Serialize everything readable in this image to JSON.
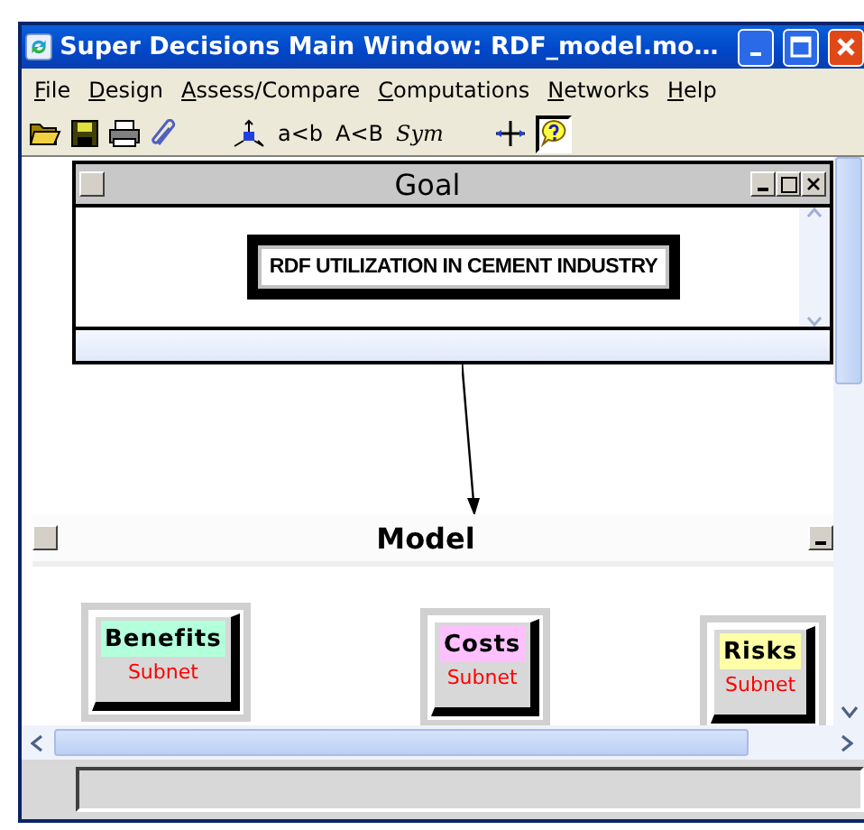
{
  "window": {
    "title": "Super Decisions Main Window: RDF_model.mo…"
  },
  "menu": [
    "File",
    "Design",
    "Assess/Compare",
    "Computations",
    "Networks",
    "Help"
  ],
  "toolbar": {
    "labels": [
      "a<b",
      "A<B",
      "Sym"
    ],
    "help_pressed": true
  },
  "goal_window": {
    "title": "Goal",
    "node": "RDF UTILIZATION IN CEMENT INDUSTRY"
  },
  "model_window": {
    "title": "Model",
    "nodes": [
      {
        "name": "Benefits",
        "sub": "Subnet",
        "color": "#b3ffdc"
      },
      {
        "name": "Costs",
        "sub": "Subnet",
        "color": "#ffc0ff"
      },
      {
        "name": "Risks",
        "sub": "Subnet",
        "color": "#ffffa8"
      }
    ]
  }
}
